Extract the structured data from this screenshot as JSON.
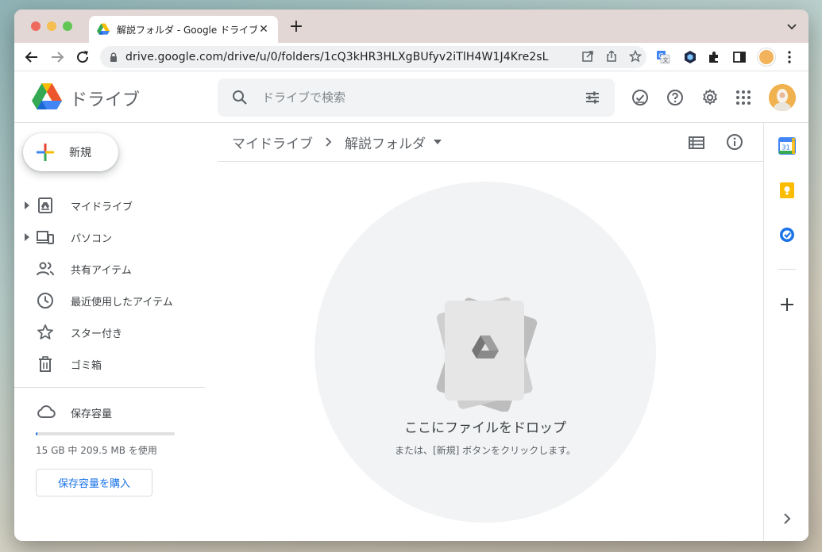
{
  "browser": {
    "tab_title": "解説フォルダ - Google ドライブ",
    "url": "drive.google.com/drive/u/0/folders/1cQ3kHR3HLXgBUfyv2iTlH4W1J4Kre2sL"
  },
  "header": {
    "app_name": "ドライブ",
    "search_placeholder": "ドライブで検索"
  },
  "sidebar": {
    "new_label": "新規",
    "items": [
      {
        "label": "マイドライブ",
        "icon": "my-drive-icon",
        "expandable": true
      },
      {
        "label": "パソコン",
        "icon": "computers-icon",
        "expandable": true
      },
      {
        "label": "共有アイテム",
        "icon": "shared-icon",
        "expandable": false
      },
      {
        "label": "最近使用したアイテム",
        "icon": "clock-icon",
        "expandable": false
      },
      {
        "label": "スター付き",
        "icon": "star-icon",
        "expandable": false
      },
      {
        "label": "ゴミ箱",
        "icon": "trash-icon",
        "expandable": false
      }
    ],
    "storage": {
      "label": "保存容量",
      "usage_text": "15 GB 中 209.5 MB を使用",
      "used_fraction": 0.014,
      "buy_label": "保存容量を購入"
    }
  },
  "main": {
    "breadcrumb": [
      "マイドライブ",
      "解説フォルダ"
    ],
    "empty_title": "ここにファイルをドロップ",
    "empty_subtitle": "または、[新規] ボタンをクリックします。"
  },
  "colors": {
    "accent": "#1a73e8",
    "google_blue": "#4285f4",
    "google_red": "#ea4335",
    "google_yellow": "#fbbc04",
    "google_green": "#34a853"
  }
}
